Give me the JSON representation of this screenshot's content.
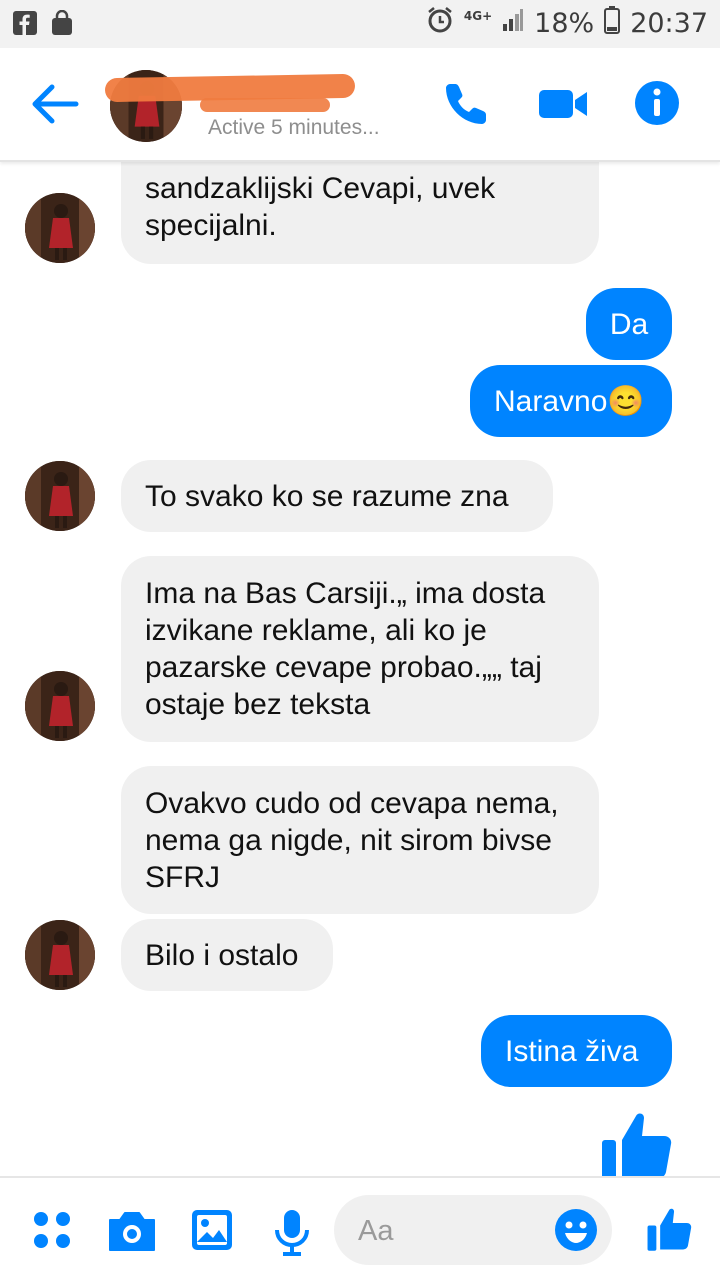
{
  "status_bar": {
    "network": "4G+",
    "battery": "18%",
    "time": "20:37"
  },
  "header": {
    "contact_name": "",
    "status": "Active 5 minutes..."
  },
  "messages": [
    {
      "side": "in",
      "text": "sandzaklijski Cevapi, uvek specijalni."
    },
    {
      "side": "out",
      "text": "Da"
    },
    {
      "side": "out",
      "text": "Naravno😊"
    },
    {
      "side": "in",
      "text": "To svako ko se razume zna"
    },
    {
      "side": "in",
      "text": "Ima na Bas Carsiji.„ ima dosta izvikane reklame, ali ko je pazarske cevape probao.„„ taj ostaje bez teksta"
    },
    {
      "side": "in",
      "text": "Ovakvo cudo od cevapa nema, nema ga nigde, nit sirom bivse SFRJ"
    },
    {
      "side": "in",
      "text": "Bilo i ostalo"
    },
    {
      "side": "out",
      "text": "Istina živa"
    }
  ],
  "composer": {
    "placeholder": "Aa"
  },
  "colors": {
    "accent": "#0084ff",
    "incoming_bubble": "#f0f0f0",
    "outgoing_text": "#ffffff"
  },
  "icons": [
    "facebook-icon",
    "bag-icon",
    "alarm-icon",
    "signal-icon",
    "battery-icon",
    "back-arrow-icon",
    "phone-icon",
    "video-icon",
    "info-icon",
    "thumbs-up-icon",
    "more-icon",
    "camera-icon",
    "gallery-icon",
    "microphone-icon",
    "emoji-icon"
  ]
}
